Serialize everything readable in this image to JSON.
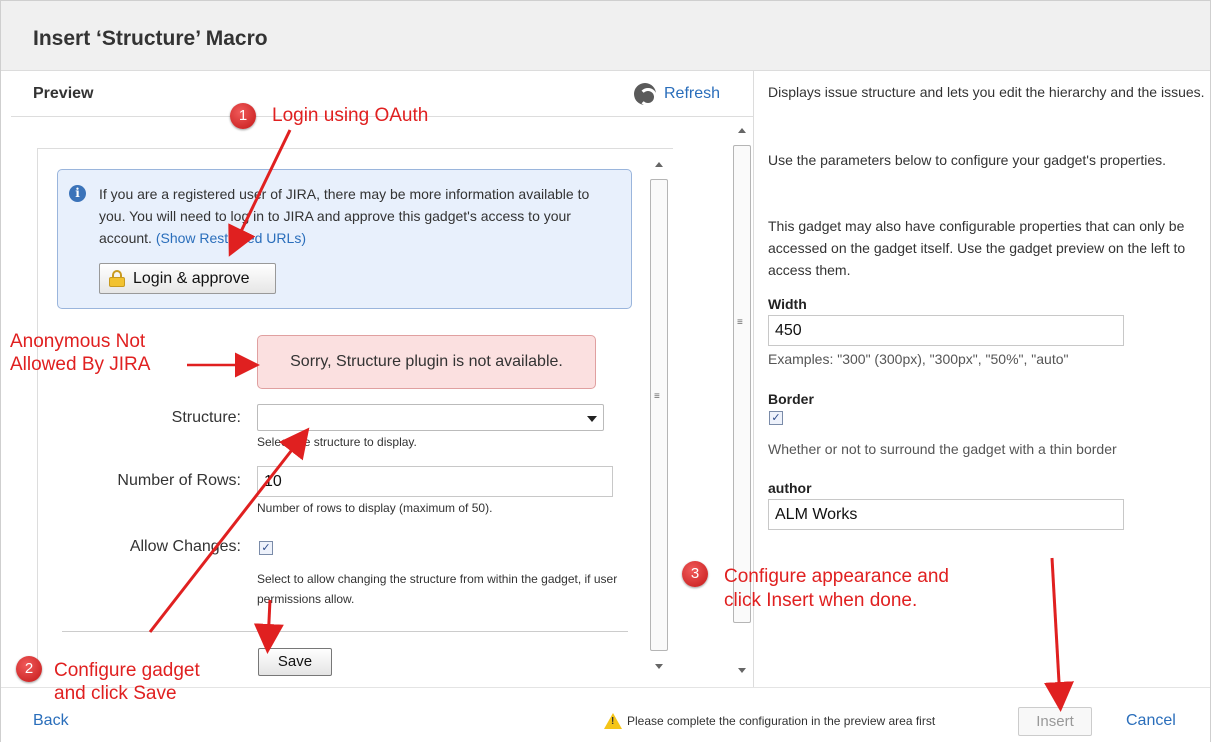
{
  "dialog": {
    "title": "Insert ‘Structure’ Macro"
  },
  "preview": {
    "title": "Preview",
    "refresh_label": "Refresh",
    "info": {
      "text_main": "If you are a registered user of JIRA, there may be more information available to you. You will need to log in to JIRA and approve this gadget's access to your account.",
      "link_label": "(Show Restricted URLs)",
      "login_button": "Login & approve"
    },
    "error": "Sorry, Structure plugin is not available.",
    "form": {
      "structure_label": "Structure:",
      "structure_value": "",
      "structure_help": "Select the structure to display.",
      "rows_label": "Number of Rows:",
      "rows_value": "10",
      "rows_help": "Number of rows to display (maximum of 50).",
      "allow_label": "Allow Changes:",
      "allow_checked": true,
      "allow_help": "Select to allow changing the structure from within the gadget, if user permissions allow.",
      "save_button": "Save"
    }
  },
  "right_panel": {
    "para1": "Displays issue structure and lets you edit the hierarchy and the issues.",
    "para2": "Use the parameters below to configure your gadget's properties.",
    "para3": "This gadget may also have configurable properties that can only be accessed on the gadget itself. Use the gadget preview on the left to access them.",
    "width_label": "Width",
    "width_value": "450",
    "width_help": "Examples: \"300\" (300px), \"300px\", \"50%\", \"auto\"",
    "border_label": "Border",
    "border_checked": true,
    "border_help": "Whether or not to surround the gadget with a thin border",
    "author_label": "author",
    "author_value": "ALM Works"
  },
  "footer": {
    "back": "Back",
    "warning": "Please complete the configuration in the preview area first",
    "insert": "Insert",
    "cancel": "Cancel"
  },
  "annotations": {
    "a1_num": "1",
    "a1_text": "Login using OAuth",
    "a2_num": "2",
    "a2_line1": "Configure gadget",
    "a2_line2": "and click Save",
    "a3_num": "3",
    "a3_line1": "Configure appearance and",
    "a3_line2": "click Insert when done.",
    "anon_line1": "Anonymous Not",
    "anon_line2": "Allowed By JIRA"
  },
  "colors": {
    "link": "#2a6ebb",
    "annotation": "#e02020"
  }
}
